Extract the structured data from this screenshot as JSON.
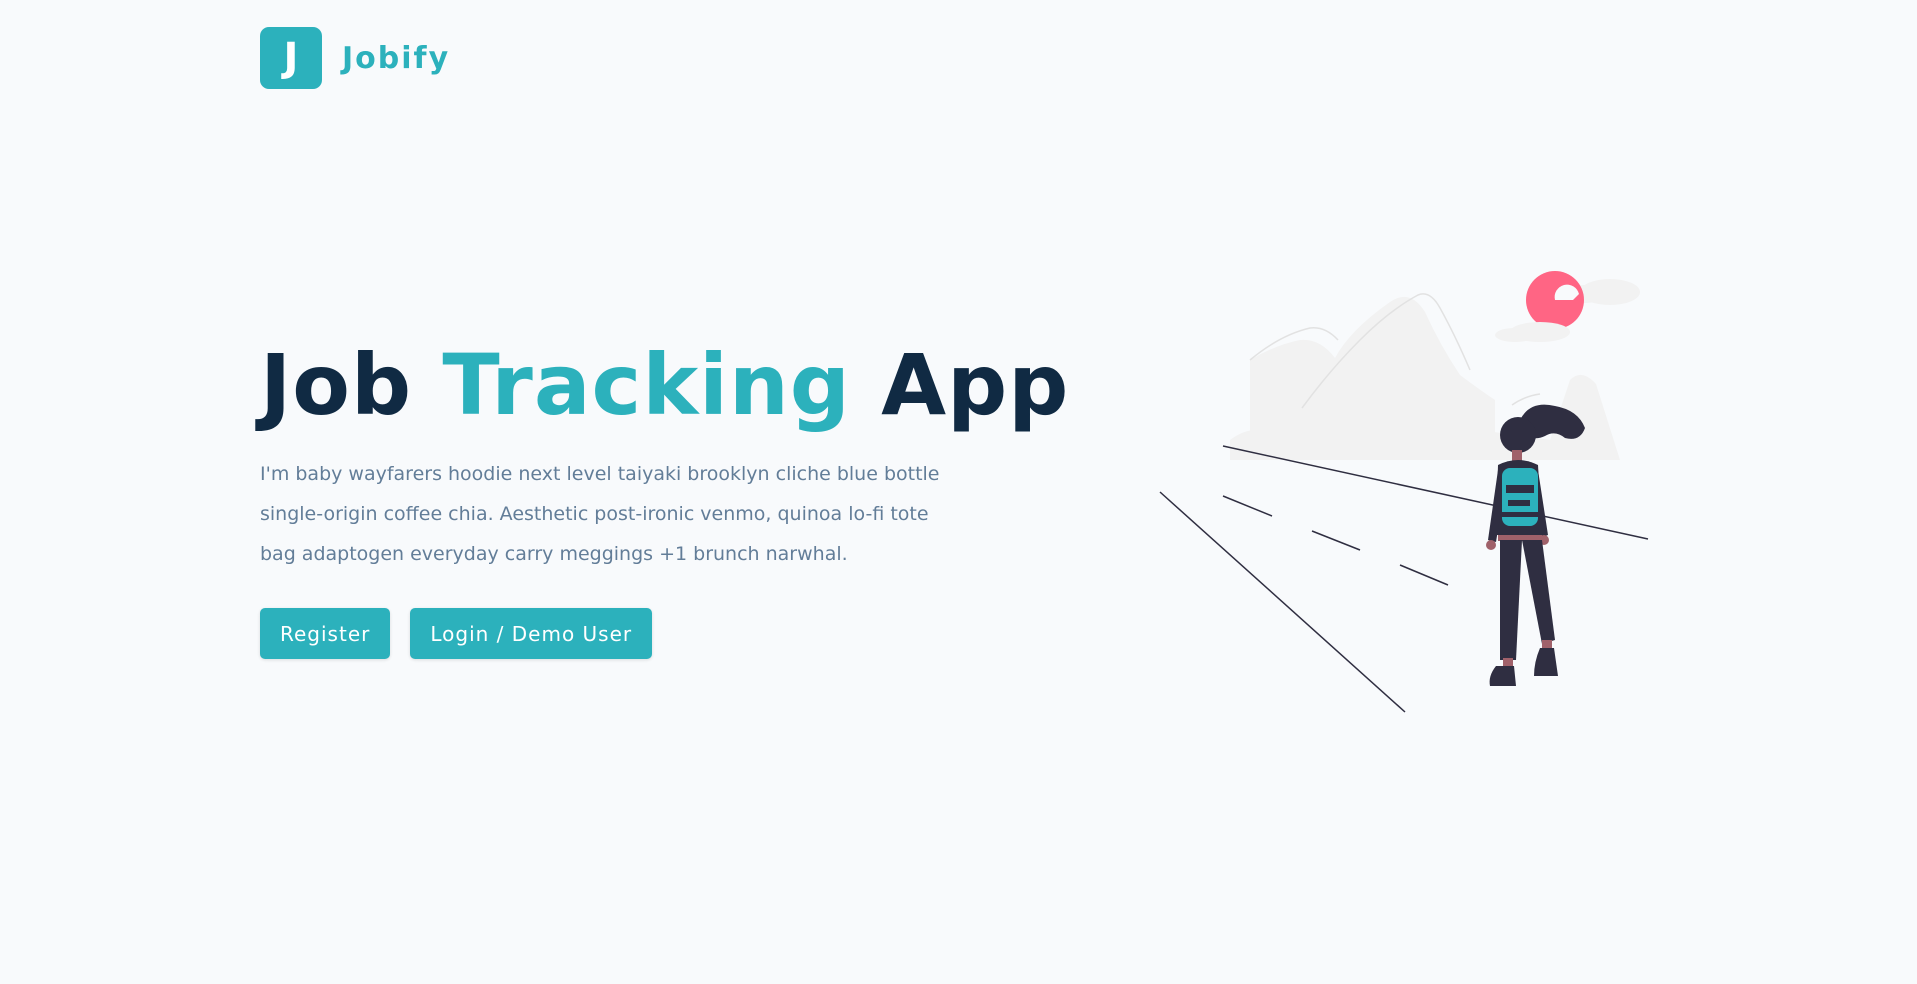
{
  "brand": {
    "logo_letter": "J",
    "name": "Jobify"
  },
  "hero": {
    "title_part1": "Job ",
    "title_accent": "Tracking",
    "title_part2": " App",
    "description": "I'm baby wayfarers hoodie next level taiyaki brooklyn cliche blue bottle single-origin coffee chia. Aesthetic post-ironic venmo, quinoa lo-fi tote bag adaptogen everyday carry meggings +1 brunch narwhal."
  },
  "actions": {
    "register_label": "Register",
    "login_label": "Login / Demo User"
  },
  "colors": {
    "primary": "#2cb1bc",
    "heading": "#102a43",
    "body_text": "#627d98",
    "background": "#f8fafc",
    "sun": "#ff6584",
    "figure_dark": "#2f2e41"
  },
  "illustration": {
    "icon": "woman-with-backpack-on-road-illustration"
  }
}
